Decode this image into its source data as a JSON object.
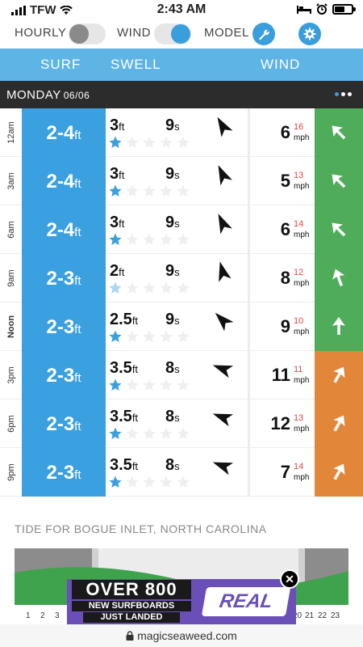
{
  "status_bar": {
    "carrier": "TFW",
    "time": "2:43 AM",
    "battery_level": 0.6
  },
  "controls": {
    "hourly_label": "HOURLY",
    "hourly_on": false,
    "wind_label": "WIND",
    "wind_on": true,
    "model_label": "MODEL",
    "model_icon": "wrench-icon",
    "settings_icon": "gear-icon",
    "accent_color": "#3a9ddc"
  },
  "tabs": {
    "surf": "SURF",
    "swell": "SWELL",
    "wind": "WIND"
  },
  "day_header": {
    "day": "MONDAY",
    "date": "06/06"
  },
  "rows": [
    {
      "time": "12am",
      "surf": "2-4",
      "surf_unit": "ft",
      "swell_height": "3",
      "swell_unit": "ft",
      "swell_period": "9",
      "period_unit": "s",
      "stars": 1,
      "star_faded": false,
      "swell_dir_deg": -30,
      "wind_speed": "6",
      "wind_gust": "16",
      "wind_unit": "mph",
      "wind_dir_deg": 225,
      "wind_color": "#4fac5a"
    },
    {
      "time": "3am",
      "surf": "2-4",
      "surf_unit": "ft",
      "swell_height": "3",
      "swell_unit": "ft",
      "swell_period": "9",
      "period_unit": "s",
      "stars": 1,
      "star_faded": false,
      "swell_dir_deg": -25,
      "wind_speed": "5",
      "wind_gust": "13",
      "wind_unit": "mph",
      "wind_dir_deg": 225,
      "wind_color": "#4fac5a"
    },
    {
      "time": "6am",
      "surf": "2-4",
      "surf_unit": "ft",
      "swell_height": "3",
      "swell_unit": "ft",
      "swell_period": "9",
      "period_unit": "s",
      "stars": 1,
      "star_faded": false,
      "swell_dir_deg": -25,
      "wind_speed": "6",
      "wind_gust": "14",
      "wind_unit": "mph",
      "wind_dir_deg": 225,
      "wind_color": "#4fac5a"
    },
    {
      "time": "9am",
      "surf": "2-3",
      "surf_unit": "ft",
      "swell_height": "2",
      "swell_unit": "ft",
      "swell_period": "9",
      "period_unit": "s",
      "stars": 1,
      "star_faded": true,
      "swell_dir_deg": -15,
      "wind_speed": "8",
      "wind_gust": "12",
      "wind_unit": "mph",
      "wind_dir_deg": 250,
      "wind_color": "#4fac5a"
    },
    {
      "time": "Noon",
      "surf": "2-3",
      "surf_unit": "ft",
      "swell_height": "2.5",
      "swell_unit": "ft",
      "swell_period": "9",
      "period_unit": "s",
      "stars": 1,
      "star_faded": false,
      "swell_dir_deg": -45,
      "wind_speed": "9",
      "wind_gust": "10",
      "wind_unit": "mph",
      "wind_dir_deg": 270,
      "wind_color": "#4fac5a"
    },
    {
      "time": "3pm",
      "surf": "2-3",
      "surf_unit": "ft",
      "swell_height": "3.5",
      "swell_unit": "ft",
      "swell_period": "8",
      "period_unit": "s",
      "stars": 1,
      "star_faded": false,
      "swell_dir_deg": -70,
      "wind_speed": "11",
      "wind_gust": "11",
      "wind_unit": "mph",
      "wind_dir_deg": 300,
      "wind_color": "#e2873a"
    },
    {
      "time": "6pm",
      "surf": "2-3",
      "surf_unit": "ft",
      "swell_height": "3.5",
      "swell_unit": "ft",
      "swell_period": "8",
      "period_unit": "s",
      "stars": 1,
      "star_faded": false,
      "swell_dir_deg": -70,
      "wind_speed": "12",
      "wind_gust": "13",
      "wind_unit": "mph",
      "wind_dir_deg": 300,
      "wind_color": "#e2873a"
    },
    {
      "time": "9pm",
      "surf": "2-3",
      "surf_unit": "ft",
      "swell_height": "3.5",
      "swell_unit": "ft",
      "swell_period": "8",
      "period_unit": "s",
      "stars": 1,
      "star_faded": false,
      "swell_dir_deg": -70,
      "wind_speed": "7",
      "wind_gust": "14",
      "wind_unit": "mph",
      "wind_dir_deg": 300,
      "wind_color": "#e2873a"
    }
  ],
  "tide": {
    "title": "TIDE FOR BOGUE INLET, NORTH CAROLINA",
    "hour_labels_left": [
      "1",
      "2",
      "3"
    ],
    "hour_labels_right": [
      "20",
      "21",
      "22",
      "23"
    ]
  },
  "ad": {
    "headline": "OVER 800",
    "line2": "NEW SURFBOARDS",
    "line3": "JUST LANDED",
    "brand": "REAL",
    "close_icon": "close-icon"
  },
  "url_bar": {
    "url": "magicseaweed.com",
    "lock_icon": "lock-icon"
  }
}
